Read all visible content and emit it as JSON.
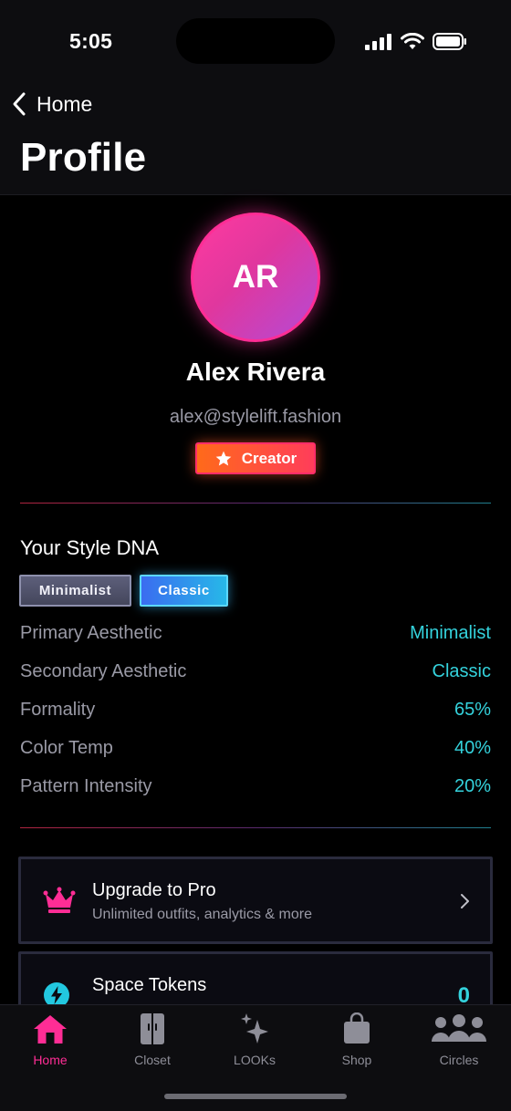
{
  "status_bar": {
    "time": "5:05"
  },
  "nav": {
    "back_label": "Home",
    "title": "Profile"
  },
  "profile": {
    "initials": "AR",
    "name": "Alex Rivera",
    "email": "alex@stylelift.fashion",
    "badge": "Creator"
  },
  "style_dna": {
    "title": "Your Style DNA",
    "chips": [
      "Minimalist",
      "Classic"
    ],
    "rows": [
      {
        "label": "Primary Aesthetic",
        "value": "Minimalist"
      },
      {
        "label": "Secondary Aesthetic",
        "value": "Classic"
      },
      {
        "label": "Formality",
        "value": "65%"
      },
      {
        "label": "Color Temp",
        "value": "40%"
      },
      {
        "label": "Pattern Intensity",
        "value": "20%"
      }
    ]
  },
  "cards": {
    "pro": {
      "title": "Upgrade to Pro",
      "subtitle": "Unlimited outfits, analytics & more",
      "icon": "crown-icon"
    },
    "tokens": {
      "title": "Space Tokens",
      "value": "0",
      "icon": "lightning-icon"
    }
  },
  "tabs": [
    {
      "label": "Home",
      "icon": "home-icon",
      "active": true
    },
    {
      "label": "Closet",
      "icon": "closet-icon",
      "active": false
    },
    {
      "label": "LOOKs",
      "icon": "sparkles-icon",
      "active": false
    },
    {
      "label": "Shop",
      "icon": "shopping-bag-icon",
      "active": false
    },
    {
      "label": "Circles",
      "icon": "people-icon",
      "active": false
    }
  ],
  "colors": {
    "accent_pink": "#ff2d95",
    "accent_cyan": "#34d2dc",
    "badge_orange": "#ff6a1a",
    "background": "#000000"
  }
}
